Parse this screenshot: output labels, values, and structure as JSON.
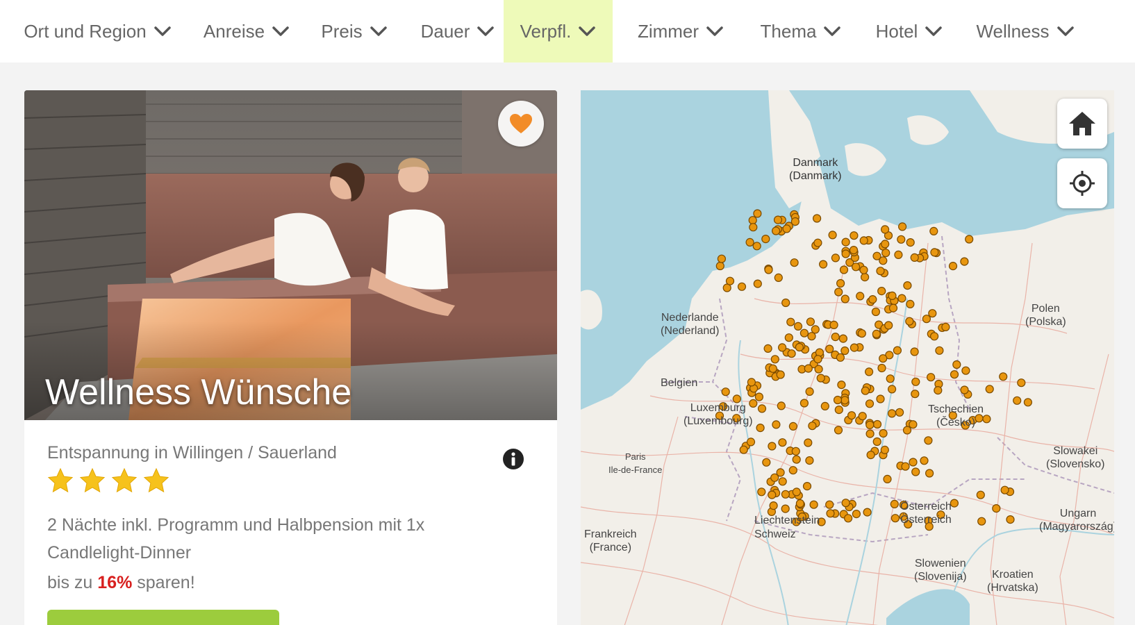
{
  "filters": [
    {
      "label": "Ort und Region",
      "active": false
    },
    {
      "label": "Anreise",
      "active": false
    },
    {
      "label": "Preis",
      "active": false
    },
    {
      "label": "Dauer",
      "active": false
    },
    {
      "label": "Verpfl.",
      "active": true
    },
    {
      "label": "Zimmer",
      "active": false
    },
    {
      "label": "Thema",
      "active": false
    },
    {
      "label": "Hotel",
      "active": false
    },
    {
      "label": "Wellness",
      "active": false
    }
  ],
  "colors": {
    "active_filter_bg": "#eefab9",
    "accent_orange": "#f28c28",
    "save_red": "#d8201f",
    "cta_green": "#9ccc3d",
    "sea": "#aad3df",
    "land": "#f2efe9",
    "marker": "#e8960f"
  },
  "card": {
    "title": "Wellness Wünsche",
    "subtitle": "Entspannung in Willingen / Sauerland",
    "rating_stars": 4,
    "description": "2 Nächte inkl. Programm und Halbpension mit 1x Candlelight-Dinner",
    "save_prefix": "bis zu",
    "save_percent": "16%",
    "save_suffix": "sparen!",
    "favorite_icon": "heart-icon",
    "info_icon": "info-icon"
  },
  "map": {
    "home_icon": "home-icon",
    "locate_icon": "crosshair-icon",
    "labels": [
      {
        "id": "danmark",
        "text": "Danmark\n(Danmark)"
      },
      {
        "id": "nederland",
        "text": "Nederlande\n(Nederland)"
      },
      {
        "id": "belgien",
        "text": "Belgien"
      },
      {
        "id": "luxembourg",
        "text": "Luxemburg\n(Luxembourg)"
      },
      {
        "id": "paris",
        "text": "Paris\nIle-de-France"
      },
      {
        "id": "polen",
        "text": "Polen\n(Polska)"
      },
      {
        "id": "cesko",
        "text": "Tschechien\n(Česko)"
      },
      {
        "id": "slovensko",
        "text": "Slowakei\n(Slovensko)"
      },
      {
        "id": "magyarorszag",
        "text": "Ungarn\n(Magyarország)"
      },
      {
        "id": "oesterreich",
        "text": "Österreich\nÖsterreich"
      },
      {
        "id": "liechtenstein",
        "text": "Liechtenstein"
      },
      {
        "id": "schweiz",
        "text": "Schweiz"
      },
      {
        "id": "france",
        "text": "Frankreich\n(France)"
      },
      {
        "id": "slovenija",
        "text": "Slowenien\n(Slovenija)"
      },
      {
        "id": "hrvatska",
        "text": "Kroatien\n(Hrvatska)"
      }
    ]
  }
}
